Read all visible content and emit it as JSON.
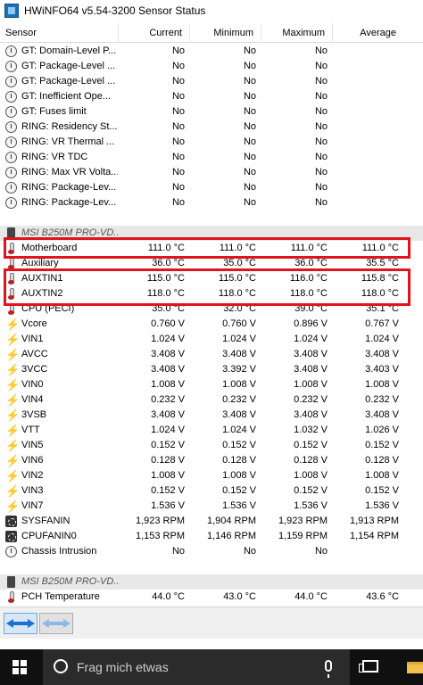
{
  "window": {
    "title": "HWiNFO64 v5.54-3200 Sensor Status"
  },
  "header": {
    "sensor": "Sensor",
    "current": "Current",
    "minimum": "Minimum",
    "maximum": "Maximum",
    "average": "Average"
  },
  "rows": [
    {
      "icon": "clock-icon",
      "name": "GT: Domain-Level P...",
      "current": "No",
      "minimum": "No",
      "maximum": "No",
      "average": ""
    },
    {
      "icon": "clock-icon",
      "name": "GT: Package-Level ...",
      "current": "No",
      "minimum": "No",
      "maximum": "No",
      "average": ""
    },
    {
      "icon": "clock-icon",
      "name": "GT: Package-Level ...",
      "current": "No",
      "minimum": "No",
      "maximum": "No",
      "average": ""
    },
    {
      "icon": "clock-icon",
      "name": "GT: Inefficient Ope...",
      "current": "No",
      "minimum": "No",
      "maximum": "No",
      "average": ""
    },
    {
      "icon": "clock-icon",
      "name": "GT: Fuses limit",
      "current": "No",
      "minimum": "No",
      "maximum": "No",
      "average": ""
    },
    {
      "icon": "clock-icon",
      "name": "RING: Residency St...",
      "current": "No",
      "minimum": "No",
      "maximum": "No",
      "average": ""
    },
    {
      "icon": "clock-icon",
      "name": "RING: VR Thermal ...",
      "current": "No",
      "minimum": "No",
      "maximum": "No",
      "average": ""
    },
    {
      "icon": "clock-icon",
      "name": "RING: VR TDC",
      "current": "No",
      "minimum": "No",
      "maximum": "No",
      "average": ""
    },
    {
      "icon": "clock-icon",
      "name": "RING: Max VR Volta...",
      "current": "No",
      "minimum": "No",
      "maximum": "No",
      "average": ""
    },
    {
      "icon": "clock-icon",
      "name": "RING: Package-Lev...",
      "current": "No",
      "minimum": "No",
      "maximum": "No",
      "average": ""
    },
    {
      "icon": "clock-icon",
      "name": "RING: Package-Lev...",
      "current": "No",
      "minimum": "No",
      "maximum": "No",
      "average": ""
    },
    {
      "icon": "",
      "name": "",
      "current": "",
      "minimum": "",
      "maximum": "",
      "average": ""
    },
    {
      "icon": "chip-icon",
      "name": "MSI B250M PRO-VD...",
      "current": "",
      "minimum": "",
      "maximum": "",
      "average": "",
      "group": true
    },
    {
      "icon": "thermometer-icon",
      "name": "Motherboard",
      "current": "111.0 °C",
      "minimum": "111.0 °C",
      "maximum": "111.0 °C",
      "average": "111.0 °C"
    },
    {
      "icon": "thermometer-icon",
      "name": "Auxiliary",
      "current": "36.0 °C",
      "minimum": "35.0 °C",
      "maximum": "36.0 °C",
      "average": "35.5 °C"
    },
    {
      "icon": "thermometer-icon",
      "name": "AUXTIN1",
      "current": "115.0 °C",
      "minimum": "115.0 °C",
      "maximum": "116.0 °C",
      "average": "115.8 °C"
    },
    {
      "icon": "thermometer-icon",
      "name": "AUXTIN2",
      "current": "118.0 °C",
      "minimum": "118.0 °C",
      "maximum": "118.0 °C",
      "average": "118.0 °C"
    },
    {
      "icon": "thermometer-icon",
      "name": "CPU (PECI)",
      "current": "35.0 °C",
      "minimum": "32.0 °C",
      "maximum": "39.0 °C",
      "average": "35.1 °C"
    },
    {
      "icon": "voltage-icon",
      "name": "Vcore",
      "current": "0.760 V",
      "minimum": "0.760 V",
      "maximum": "0.896 V",
      "average": "0.767 V"
    },
    {
      "icon": "voltage-icon",
      "name": "VIN1",
      "current": "1.024 V",
      "minimum": "1.024 V",
      "maximum": "1.024 V",
      "average": "1.024 V"
    },
    {
      "icon": "voltage-icon",
      "name": "AVCC",
      "current": "3.408 V",
      "minimum": "3.408 V",
      "maximum": "3.408 V",
      "average": "3.408 V"
    },
    {
      "icon": "voltage-icon",
      "name": "3VCC",
      "current": "3.408 V",
      "minimum": "3.392 V",
      "maximum": "3.408 V",
      "average": "3.403 V"
    },
    {
      "icon": "voltage-icon",
      "name": "VIN0",
      "current": "1.008 V",
      "minimum": "1.008 V",
      "maximum": "1.008 V",
      "average": "1.008 V"
    },
    {
      "icon": "voltage-icon",
      "name": "VIN4",
      "current": "0.232 V",
      "minimum": "0.232 V",
      "maximum": "0.232 V",
      "average": "0.232 V"
    },
    {
      "icon": "voltage-icon",
      "name": "3VSB",
      "current": "3.408 V",
      "minimum": "3.408 V",
      "maximum": "3.408 V",
      "average": "3.408 V"
    },
    {
      "icon": "voltage-icon",
      "name": "VTT",
      "current": "1.024 V",
      "minimum": "1.024 V",
      "maximum": "1.032 V",
      "average": "1.026 V"
    },
    {
      "icon": "voltage-icon",
      "name": "VIN5",
      "current": "0.152 V",
      "minimum": "0.152 V",
      "maximum": "0.152 V",
      "average": "0.152 V"
    },
    {
      "icon": "voltage-icon",
      "name": "VIN6",
      "current": "0.128 V",
      "minimum": "0.128 V",
      "maximum": "0.128 V",
      "average": "0.128 V"
    },
    {
      "icon": "voltage-icon",
      "name": "VIN2",
      "current": "1.008 V",
      "minimum": "1.008 V",
      "maximum": "1.008 V",
      "average": "1.008 V"
    },
    {
      "icon": "voltage-icon",
      "name": "VIN3",
      "current": "0.152 V",
      "minimum": "0.152 V",
      "maximum": "0.152 V",
      "average": "0.152 V"
    },
    {
      "icon": "voltage-icon",
      "name": "VIN7",
      "current": "1.536 V",
      "minimum": "1.536 V",
      "maximum": "1.536 V",
      "average": "1.536 V"
    },
    {
      "icon": "fan-icon",
      "name": "SYSFANIN",
      "current": "1,923 RPM",
      "minimum": "1,904 RPM",
      "maximum": "1,923 RPM",
      "average": "1,913 RPM"
    },
    {
      "icon": "fan-icon",
      "name": "CPUFANIN0",
      "current": "1,153 RPM",
      "minimum": "1,146 RPM",
      "maximum": "1,159 RPM",
      "average": "1,154 RPM"
    },
    {
      "icon": "clock-icon",
      "name": "Chassis Intrusion",
      "current": "No",
      "minimum": "No",
      "maximum": "No",
      "average": ""
    },
    {
      "icon": "",
      "name": "",
      "current": "",
      "minimum": "",
      "maximum": "",
      "average": ""
    },
    {
      "icon": "chip-icon",
      "name": "MSI B250M PRO-VD...",
      "current": "",
      "minimum": "",
      "maximum": "",
      "average": "",
      "group": true
    },
    {
      "icon": "thermometer-icon",
      "name": "PCH Temperature",
      "current": "44.0 °C",
      "minimum": "43.0 °C",
      "maximum": "44.0 °C",
      "average": "43.6 °C"
    }
  ],
  "taskbar": {
    "search_placeholder": "Frag mich etwas"
  },
  "colors": {
    "highlight": "#e0141e",
    "taskbar": "#101010"
  }
}
